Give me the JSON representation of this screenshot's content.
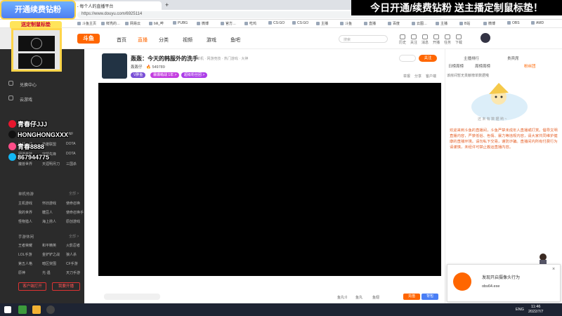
{
  "browser": {
    "tabs": [
      {
        "label": "斗鱼直播 - 每个人的直播平台"
      },
      {
        "label": "+"
      }
    ],
    "url": "https://www.douyu.com/6925114",
    "bookmarks": [
      "斗鱼主页",
      "鲜亮的…",
      "网易云",
      "bili_哔",
      "PUBG",
      "微博",
      "官方…",
      "吃鸡",
      "CS:GO",
      "CS:GO",
      "主播",
      "斗鱼",
      "直播",
      "百度",
      "云图…",
      "主播",
      "B站",
      "微博",
      "OBS",
      "AMD"
    ]
  },
  "overlay": {
    "promo_badge": "开通续费钻粉",
    "promo_sub": "送定制鼠标垫",
    "banner": "今日开通/续费钻粉 送主播定制鼠标垫！",
    "socials": [
      {
        "label": "青春仔JJJ",
        "color": "#e6162d"
      },
      {
        "label": "HONGHONGXXX",
        "color": "#111111"
      },
      {
        "label": "青春8888",
        "color": "#ff4d88"
      },
      {
        "label": "867944775",
        "color": "#12b7f5"
      }
    ]
  },
  "site_header": {
    "logo": "斗鱼",
    "nav": [
      "首页",
      "直播",
      "分类",
      "视频",
      "游戏",
      "鱼吧"
    ],
    "search_placeholder": "搜索",
    "icons": [
      {
        "label": "历史",
        "name": "history-icon"
      },
      {
        "label": "关注",
        "name": "follow-icon"
      },
      {
        "label": "消息",
        "name": "message-icon"
      },
      {
        "label": "开播",
        "name": "broadcast-icon"
      },
      {
        "label": "任务",
        "name": "task-icon"
      },
      {
        "label": "下载",
        "name": "download-icon"
      }
    ]
  },
  "sidebar": {
    "items": [
      "兑换中心",
      "云游戏"
    ],
    "game_rows": [
      [
        "网游竞技",
        "CS:GO",
        "DNF"
      ],
      [
        "穿越火线",
        "英雄联盟",
        "DOTA"
      ],
      [
        "网游竞技",
        "守望先锋",
        "DOTA"
      ],
      [
        "魔兽世界",
        "天涯明月刀",
        "三国杀"
      ]
    ],
    "section_single": "单机热游",
    "section_single_more": "全部 >",
    "single_rows": [
      [
        "主机游戏",
        "怀旧游戏",
        "使命召唤"
      ],
      [
        "我的世界",
        "糖豆人",
        "使命召唤手"
      ],
      [
        "怪物猎人",
        "海上捞人",
        "原创游戏"
      ]
    ],
    "section_mobile": "手游休闲",
    "section_mobile_more": "全部 >",
    "mobile_rows": [
      [
        "王者荣耀",
        "和平精英",
        "火影忍者"
      ],
      [
        "LOL手游",
        "金铲铲之战",
        "狼人杀"
      ],
      [
        "第五人格",
        "暗区突围",
        "CF手游"
      ],
      [
        "原神",
        "光·遇",
        "天刀手游"
      ]
    ],
    "buttons": [
      "客户端打开",
      "我要开播"
    ]
  },
  "stream": {
    "title": "轰轰：今天的韩服外的洗手",
    "category": "单机 · 网游竞技 · 热门游戏 · 大神",
    "host_name": "轰轰仔",
    "hot": "549789",
    "tags": [
      {
        "label": "V胖鱼",
        "color": "#7a4fd6"
      },
      {
        "label": "暴爆萌战 1年 >",
        "color": "#c43ee0"
      },
      {
        "label": "超级粉丝团 >",
        "color": "#ad3ee8"
      }
    ],
    "follow_label": "关注",
    "follow_count": "",
    "links": [
      "举报",
      "分享",
      "客户端"
    ],
    "bottom": {
      "gift_label": "鱼丸",
      "coins_label": "鱼翅",
      "btn1": "充值",
      "btn2": "背包",
      "balance_label": "鱼丸:0"
    }
  },
  "right_panel": {
    "tabs": [
      "主播排行",
      "贵宾席",
      "粉丝团"
    ],
    "subtabs": [
      "日榜周榜",
      "周榜周榜",
      "粉丝团"
    ],
    "rank_hint": "该房间暂无贡献榜单数据哦",
    "mascot_caption": "还 未 有 数 据 哟 ~",
    "notice": "欢迎来到斗鱼的直播间，斗鱼严禁未成年人直播或打赏。倡导文明直播内容，严禁低俗、色情、暴力等违规内容，请大家共同维护健康的直播环境。请勿私下交易，谨防诈骗。直播间内所有付费行为请谨慎，未经许可禁止搬运直播内容。"
  },
  "popup": {
    "title": "发现开启摄像头行为",
    "file": "obs64.exe"
  },
  "taskbar": {
    "lang": "ENG",
    "time": "11:46",
    "date": "2022/7/7"
  },
  "colors": {
    "accent": "#ff6600",
    "sidebar_bg": "#2b2b2b",
    "taskbar_bg": "#1e2433"
  }
}
